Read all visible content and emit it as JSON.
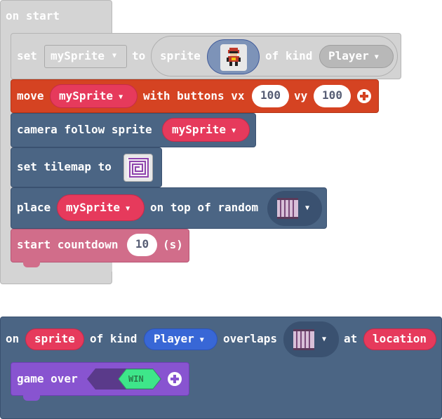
{
  "on_start": {
    "title": "on start",
    "set_block": {
      "keyword": "set",
      "variable": "mySprite",
      "to_label": "to",
      "sprite_label": "sprite",
      "of_kind_label": "of kind",
      "kind": "Player"
    },
    "move_block": {
      "keyword": "move",
      "variable": "mySprite",
      "with_buttons_label": "with buttons vx",
      "vx": "100",
      "vy_label": "vy",
      "vy": "100"
    },
    "camera_block": {
      "label": "camera follow sprite",
      "variable": "mySprite"
    },
    "tilemap_block": {
      "label": "set tilemap to"
    },
    "place_block": {
      "keyword": "place",
      "variable": "mySprite",
      "label": "on top of random"
    },
    "countdown_block": {
      "label": "start countdown",
      "value": "10",
      "unit": "(s)"
    }
  },
  "overlap_event": {
    "on_label": "on",
    "sprite_label": "sprite",
    "of_kind_label": "of kind",
    "kind": "Player",
    "overlaps_label": "overlaps",
    "at_label": "at",
    "location_label": "location",
    "game_over_block": {
      "label": "game over",
      "result": "WIN"
    }
  },
  "colors": {
    "event_gray": "#cfcfcf",
    "variables_gray": "#d3d3d3",
    "controller_orange": "#d54322",
    "scene_blue": "#4b6584",
    "info_pink": "#d16d8a",
    "game_purple": "#8854d0",
    "variable_red": "#e63a5c",
    "kind_blue": "#3867d6",
    "win_green": "#3ee68a"
  }
}
